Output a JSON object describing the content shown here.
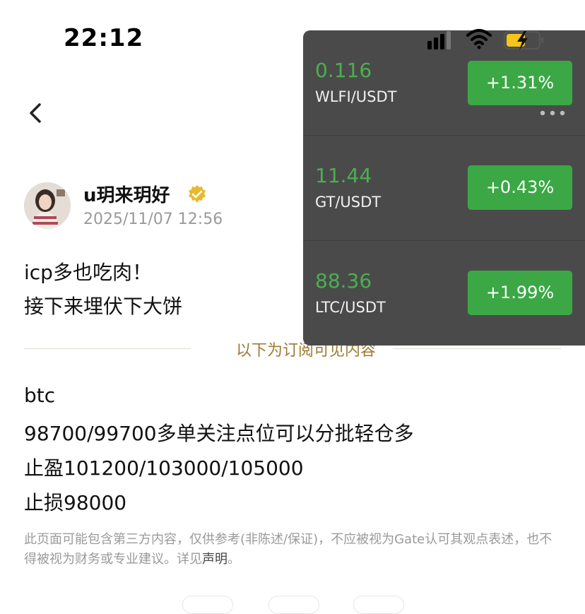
{
  "status_bar": {
    "time": "22:12"
  },
  "icons": {
    "back": "chevron-left-icon",
    "verified": "verified-badge-icon",
    "signal": "cellular-signal-icon",
    "wifi": "wifi-icon",
    "battery": "battery-charging-icon",
    "more": "more-dots-icon"
  },
  "post": {
    "author": "u玥来玥好",
    "time": "2025/11/07 12:56",
    "lines": [
      "icp多也吃肉！",
      "接下来埋伏下大饼"
    ],
    "subscriber_divider": "以下为订阅可见内容",
    "subscriber_lines": [
      "btc",
      "98700/99700多单关注点位可以分批轻仓多",
      "止盈101200/103000/105000",
      "止损98000"
    ],
    "disclaimer_text": "此页面可能包含第三方内容，仅供参考(非陈述/保证)，不应被视为Gate认可其观点表述，也不得被视为财务或专业建议。详见",
    "disclaimer_link": "声明",
    "disclaimer_end": "。"
  },
  "ticker": {
    "items": [
      {
        "price": "0.116",
        "pair": "WLFI/USDT",
        "change": "+1.31%"
      },
      {
        "price": "11.44",
        "pair": "GT/USDT",
        "change": "+0.43%"
      },
      {
        "price": "88.36",
        "pair": "LTC/USDT",
        "change": "+1.99%"
      }
    ],
    "colors": {
      "background": "#4a4a4a",
      "price_green": "#4caf50",
      "button_green": "#3ba845"
    }
  },
  "colors": {
    "divider_gold": "#9c7b34",
    "muted": "#9a9a9a"
  }
}
